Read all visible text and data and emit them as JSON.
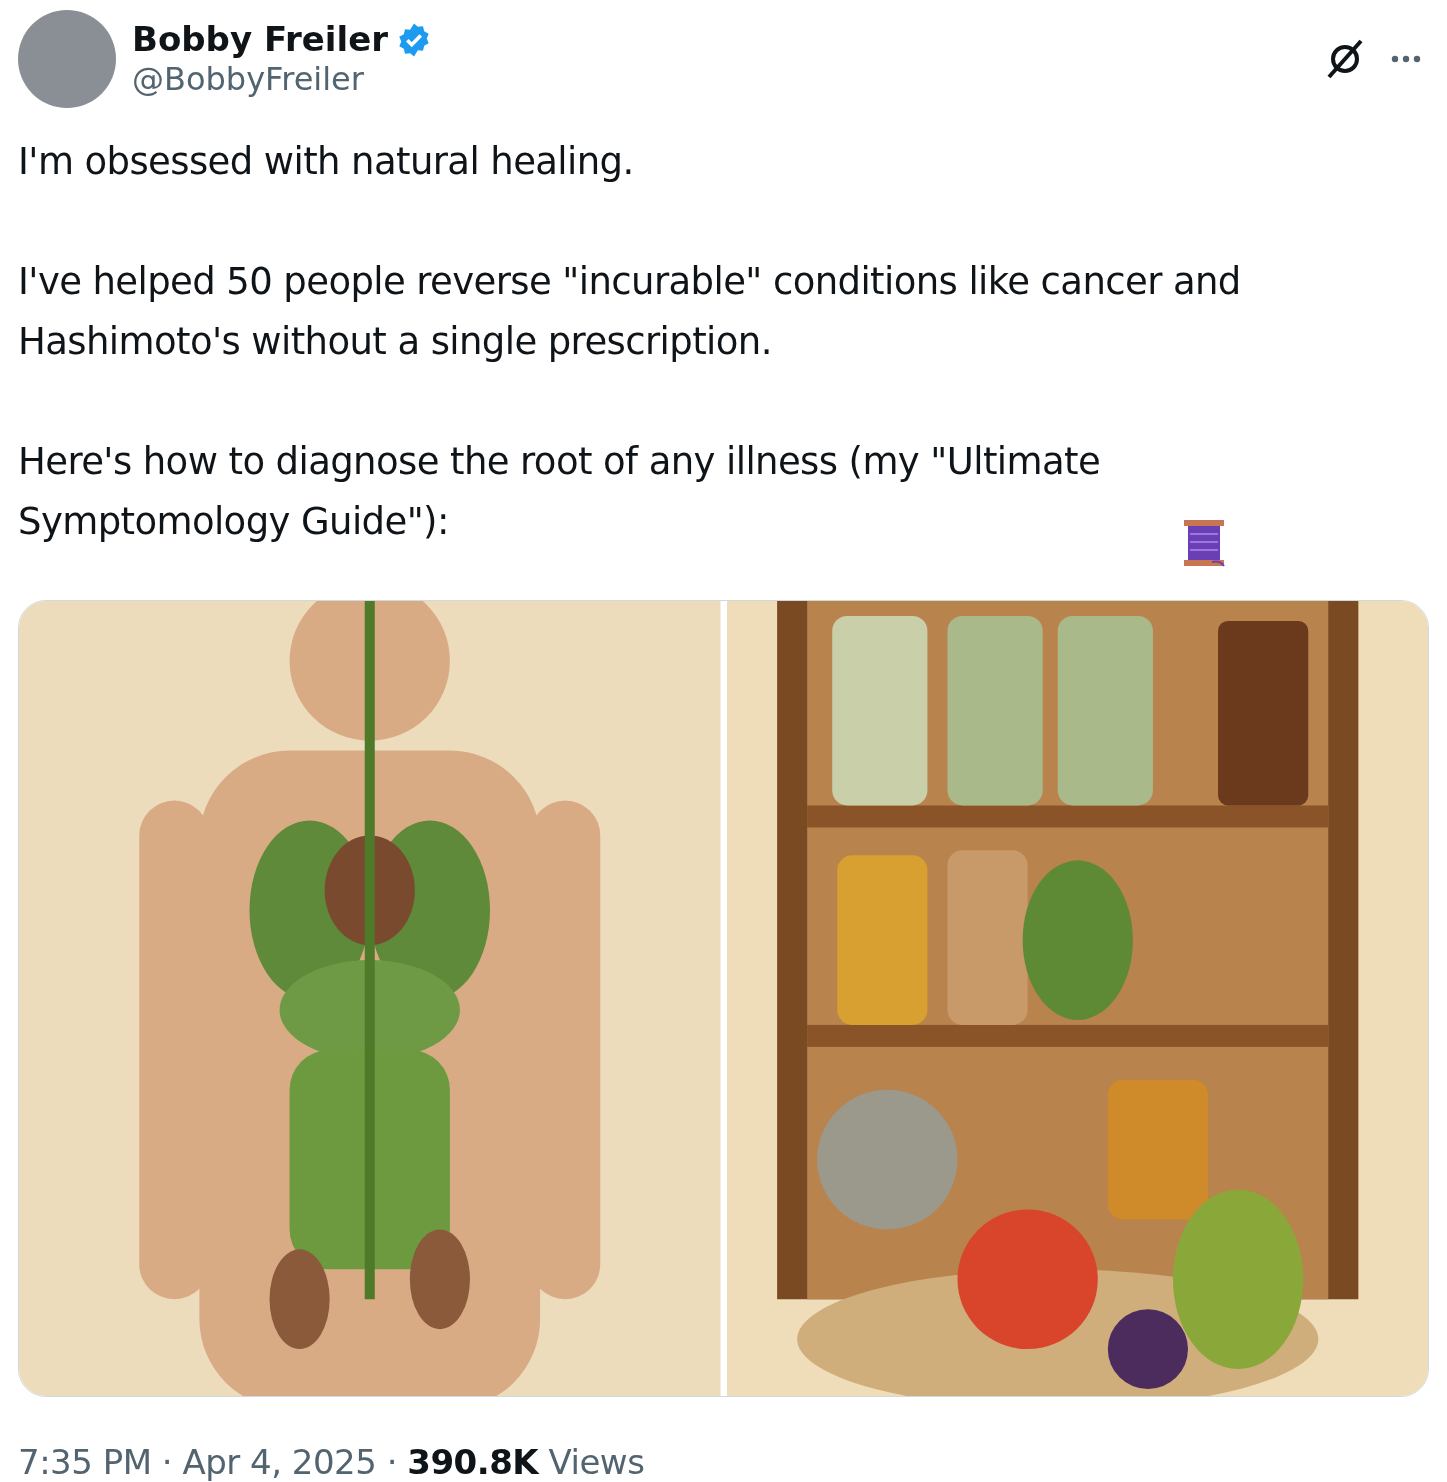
{
  "author": {
    "name": "Bobby Freiler",
    "verified": true,
    "handle": "@BobbyFreiler"
  },
  "paragraphs": [
    "I'm obsessed with natural healing.",
    "I've helped 50 people reverse \"incurable\" conditions like cancer and Hashimoto's without a single prescription.",
    "Here's how to diagnose the root of any illness (my \"Ultimate Symptomology Guide\"):"
  ],
  "footer": {
    "time": "7:35 PM",
    "separator": "·",
    "date": "Apr 4, 2025",
    "views_count": "390.8K",
    "views_label": "Views"
  }
}
